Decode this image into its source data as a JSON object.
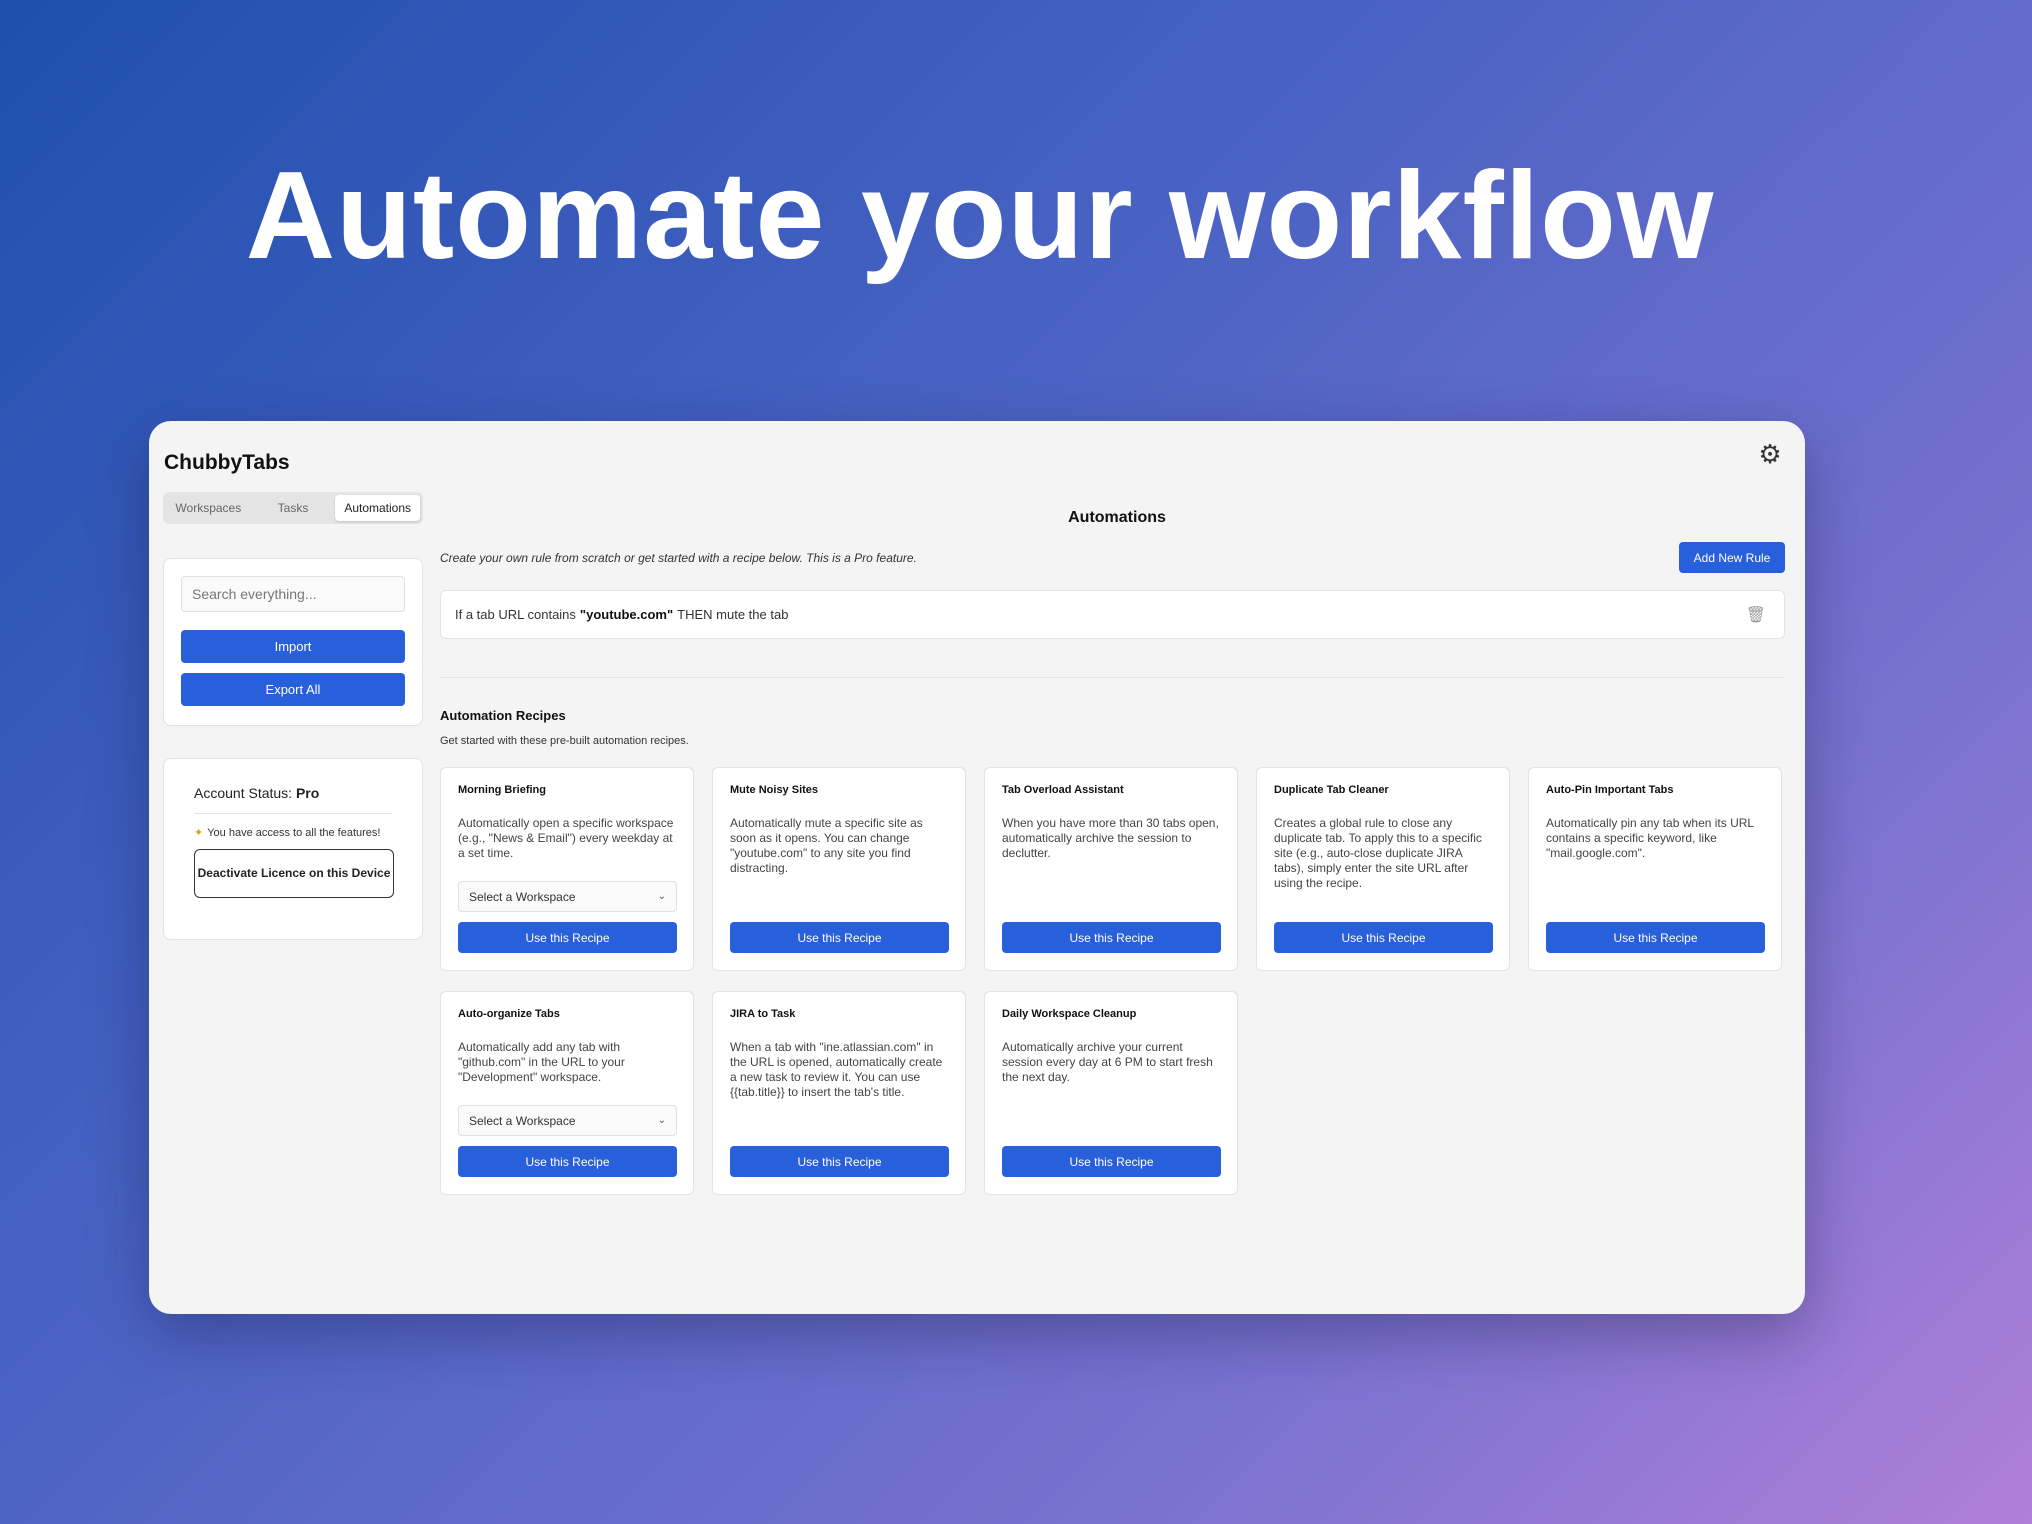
{
  "hero": {
    "title": "Automate your workflow"
  },
  "app": {
    "title": "ChubbyTabs",
    "settings_icon": "gear-icon"
  },
  "tabs": [
    {
      "label": "Workspaces",
      "active": false
    },
    {
      "label": "Tasks",
      "active": false
    },
    {
      "label": "Automations",
      "active": true
    }
  ],
  "sidebar": {
    "search_placeholder": "Search everything...",
    "import_label": "Import",
    "export_label": "Export All",
    "account_label": "Account Status: ",
    "account_value": "Pro",
    "account_note": "You have access to all the features!",
    "deactivate_label": "Deactivate Licence on this Device"
  },
  "main": {
    "title": "Automations",
    "description": "Create your own rule from scratch or get started with a recipe below. This is a Pro feature.",
    "add_rule_label": "Add New Rule",
    "rule": {
      "prefix": "If a tab URL contains",
      "keyword": "\"youtube.com\"",
      "suffix": "THEN mute the tab"
    },
    "recipes_title": "Automation Recipes",
    "recipes_subtitle": "Get started with these pre-built automation recipes.",
    "recipe_button_label": "Use this Recipe",
    "select_placeholder": "Select a Workspace"
  },
  "recipes": [
    {
      "title": "Morning Briefing",
      "desc": "Automatically open a specific workspace (e.g., \"News & Email\") every weekday at a set time.",
      "has_select": true
    },
    {
      "title": "Mute Noisy Sites",
      "desc": "Automatically mute a specific site as soon as it opens. You can change \"youtube.com\" to any site you find distracting.",
      "has_select": false
    },
    {
      "title": "Tab Overload Assistant",
      "desc": "When you have more than 30 tabs open, automatically archive the session to declutter.",
      "has_select": false
    },
    {
      "title": "Duplicate Tab Cleaner",
      "desc": "Creates a global rule to close any duplicate tab. To apply this to a specific site (e.g., auto-close duplicate JIRA tabs), simply enter the site URL after using the recipe.",
      "has_select": false
    },
    {
      "title": "Auto-Pin Important Tabs",
      "desc": "Automatically pin any tab when its URL contains a specific keyword, like \"mail.google.com\".",
      "has_select": false
    },
    {
      "title": "Auto-organize Tabs",
      "desc": "Automatically add any tab with \"github.com\" in the URL to your \"Development\" workspace.",
      "has_select": true
    },
    {
      "title": "JIRA to Task",
      "desc": "When a tab with \"ine.atlassian.com\" in the URL is opened, automatically create a new task to review it. You can use {{tab.title}} to insert the tab's title.",
      "has_select": false
    },
    {
      "title": "Daily Workspace Cleanup",
      "desc": "Automatically archive your current session every day at 6 PM to start fresh the next day.",
      "has_select": false
    }
  ]
}
